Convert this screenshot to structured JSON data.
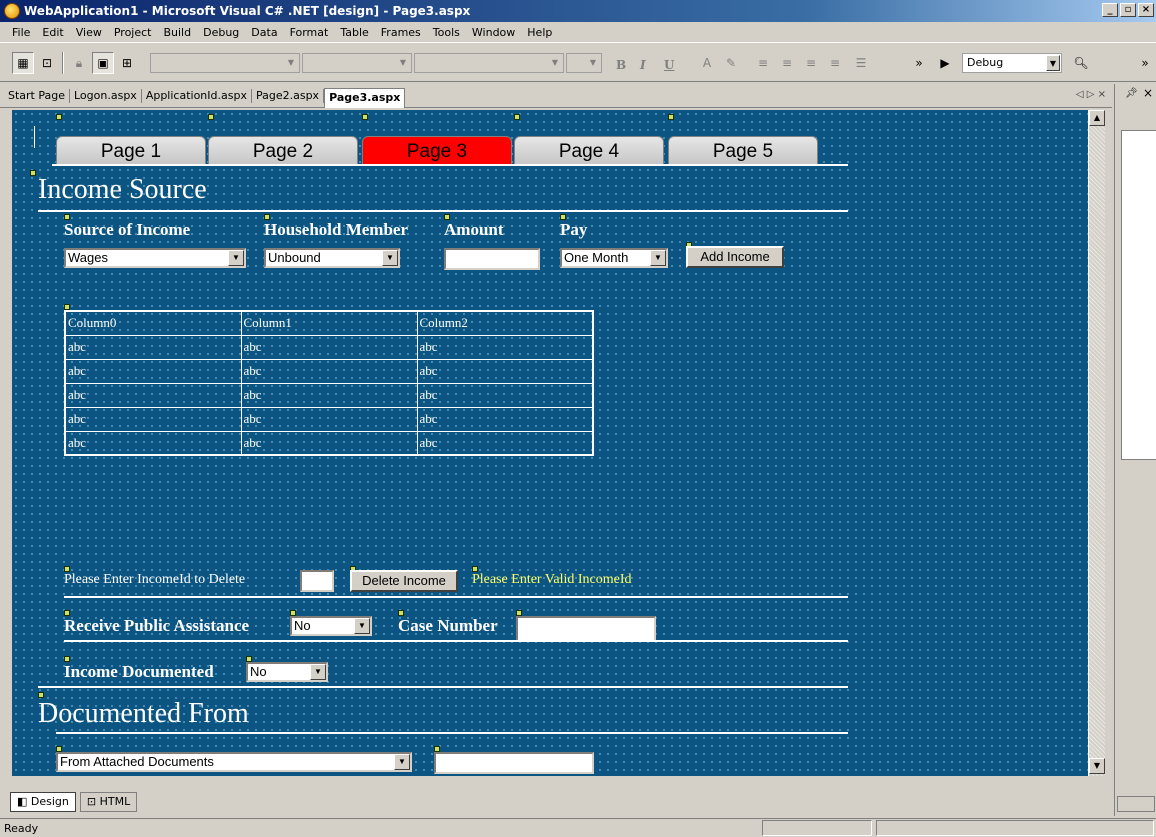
{
  "window": {
    "title": "WebApplication1 - Microsoft Visual C# .NET [design] - Page3.aspx",
    "buttons": [
      "_",
      "▫",
      "×"
    ]
  },
  "menu": [
    "File",
    "Edit",
    "View",
    "Project",
    "Build",
    "Debug",
    "Data",
    "Format",
    "Table",
    "Frames",
    "Tools",
    "Window",
    "Help"
  ],
  "toolbar": {
    "config": "Debug",
    "format_glyphs": [
      "B",
      "I",
      "U"
    ]
  },
  "doc_tabs": [
    "Start Page",
    "Logon.aspx",
    "ApplicationId.aspx",
    "Page2.aspx",
    "Page3.aspx"
  ],
  "doc_tab_active": "Page3.aspx",
  "doc_tab_nav": "◁ ▷ ×",
  "page_tabs": [
    "Page 1",
    "Page 2",
    "Page 3",
    "Page 4",
    "Page 5"
  ],
  "page_tab_active": "Page 3",
  "colors": {
    "surface": "#0c5582",
    "active_tab": "#ff0000",
    "validation": "#ffff66"
  },
  "income": {
    "heading": "Income Source",
    "source_label": "Source of Income",
    "member_label": "Household Member",
    "amount_label": "Amount",
    "pay_label": "Pay",
    "source_value": "Wages",
    "member_value": "Unbound",
    "amount_value": "",
    "pay_value": "One Month",
    "add_button": "Add Income"
  },
  "grid": {
    "columns": [
      "Column0",
      "Column1",
      "Column2"
    ],
    "rows": [
      [
        "abc",
        "abc",
        "abc"
      ],
      [
        "abc",
        "abc",
        "abc"
      ],
      [
        "abc",
        "abc",
        "abc"
      ],
      [
        "abc",
        "abc",
        "abc"
      ],
      [
        "abc",
        "abc",
        "abc"
      ]
    ]
  },
  "delete": {
    "prompt": "Please Enter IncomeId to Delete",
    "button": "Delete Income",
    "validation": "Please Enter Valid IncomeId"
  },
  "assistance": {
    "label": "Receive Public Assistance",
    "value": "No",
    "case_label": "Case Number"
  },
  "documented": {
    "label": "Income Documented",
    "value": "No"
  },
  "documented_from": {
    "heading": "Documented From",
    "value": "From Attached Documents"
  },
  "view_tabs": [
    "Design",
    "HTML"
  ],
  "status": "Ready"
}
